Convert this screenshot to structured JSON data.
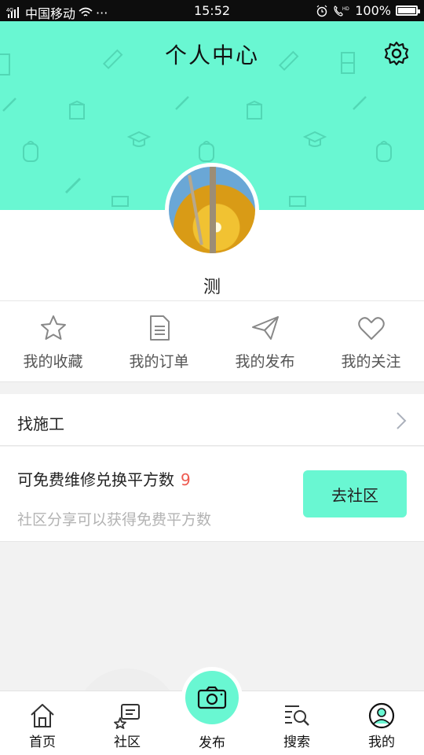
{
  "status_bar": {
    "carrier": "中国移动",
    "network": "4G",
    "dots": "···",
    "time": "15:52",
    "battery_text": "100%",
    "battery_level": 1.0
  },
  "header": {
    "title": "个人中心",
    "icon": "gear-icon",
    "bg_color": "#69f7d2"
  },
  "profile": {
    "username": "测"
  },
  "shortcuts": [
    {
      "label": "我的收藏",
      "icon": "star-icon"
    },
    {
      "label": "我的订单",
      "icon": "document-icon"
    },
    {
      "label": "我的发布",
      "icon": "paper-plane-icon"
    },
    {
      "label": "我的关注",
      "icon": "heart-icon"
    }
  ],
  "menu": {
    "find_worker": "找施工"
  },
  "points": {
    "title": "可免费维修兑换平方数",
    "count": "9",
    "subtitle": "社区分享可以获得免费平方数",
    "button": "去社区"
  },
  "tabs": [
    {
      "label": "首页",
      "icon": "home-icon"
    },
    {
      "label": "社区",
      "icon": "community-icon"
    },
    {
      "label": "发布",
      "icon": "camera-icon"
    },
    {
      "label": "搜索",
      "icon": "search-icon"
    },
    {
      "label": "我的",
      "icon": "profile-icon"
    }
  ],
  "colors": {
    "accent": "#69f7d2",
    "count": "#ee5a50"
  }
}
